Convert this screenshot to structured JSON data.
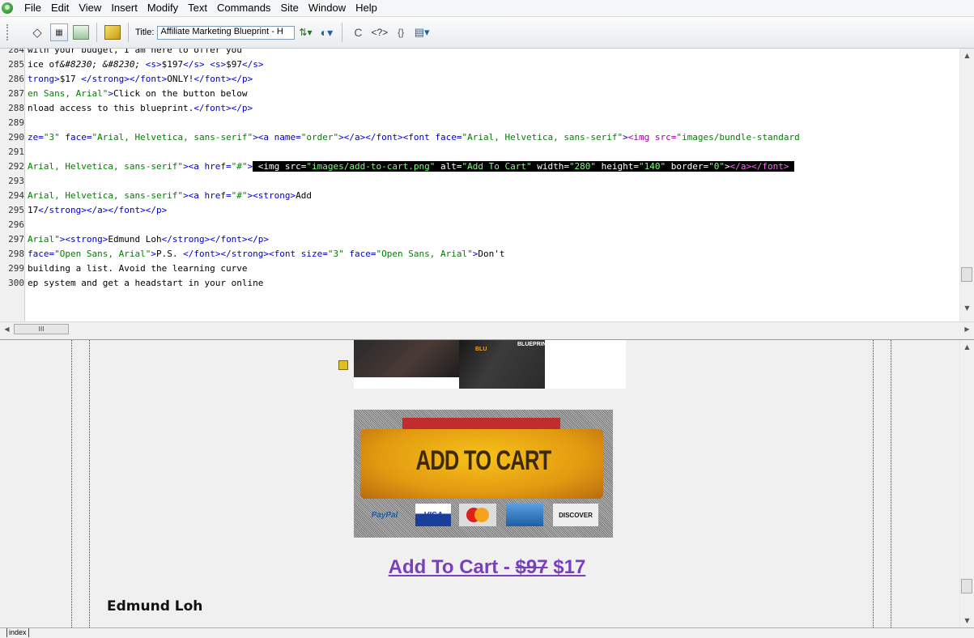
{
  "menu": [
    "File",
    "Edit",
    "View",
    "Insert",
    "Modify",
    "Text",
    "Commands",
    "Site",
    "Window",
    "Help"
  ],
  "toolbar": {
    "title_label": "Title:",
    "title_value": "Affiliate Marketing Blueprint - H",
    "code_glyph": "◇",
    "refresh_glyph": "C",
    "tag_glyph": "<?>",
    "brace_glyph": "{}"
  },
  "code_lines": [
    {
      "n": "284",
      "html": "<span class='txt'>with your budget, I am here to offer you</span>"
    },
    {
      "n": "285",
      "html": "<span class='txt'>ice of</span><span class='ent'>&amp;#8230; &amp;#8230;</span><span class='txt'> </span><span class='tag'>&lt;s&gt;</span><span class='txt'>$197</span><span class='tag'>&lt;/s&gt;</span><span class='txt'> </span><span class='tag'>&lt;s&gt;</span><span class='txt'>$97</span><span class='tag'>&lt;/s&gt;</span>"
    },
    {
      "n": "286",
      "html": "<span class='tag'>trong&gt;</span><span class='txt'>$17 </span><span class='tag'>&lt;/strong&gt;&lt;/font&gt;</span><span class='txt'>ONLY!</span><span class='tag'>&lt;/font&gt;&lt;/p&gt;</span>"
    },
    {
      "n": "287",
      "html": "<span class='str'>en Sans, Arial\"</span><span class='tag'>&gt;</span><span class='txt'>Click on the button below</span>"
    },
    {
      "n": "288",
      "html": "<span class='txt'>nload access to this blueprint.</span><span class='tag'>&lt;/font&gt;&lt;/p&gt;</span>"
    },
    {
      "n": "289",
      "html": ""
    },
    {
      "n": "290",
      "html": "<span class='attr'>ze=</span><span class='str'>\"3\"</span><span class='attr'> face=</span><span class='str'>\"Arial, Helvetica, sans-serif\"</span><span class='tag'>&gt;&lt;a name=</span><span class='str'>\"order\"</span><span class='tag'>&gt;&lt;/a&gt;&lt;/font&gt;&lt;font face=</span><span class='str'>\"Arial, Helvetica, sans-serif\"</span><span class='tag'>&gt;</span><span style='color:#a000a0'>&lt;img src=</span><span class='str'>\"images/bundle-standard</span>"
    },
    {
      "n": "291",
      "html": ""
    },
    {
      "n": "292",
      "html": "<span class='str'>Arial, Helvetica, sans-serif\"</span><span class='tag'>&gt;&lt;a href=</span><span class='str'>\"#\"</span><span class='tag'>&gt;</span><span class='hl'> &lt;img src=<span class='hls'>\"images/add-to-cart.png\"</span> alt=<span class='hls'>\"Add To Cart\"</span> width=<span class='hls'>\"280\"</span> height=<span class='hls'>\"140\"</span> border=<span class='hls'>\"0\"</span>&gt;<span class='hlt'>&lt;/a&gt;&lt;/font&gt;</span> </span>"
    },
    {
      "n": "293",
      "html": ""
    },
    {
      "n": "294",
      "html": "<span class='str'>Arial, Helvetica, sans-serif\"</span><span class='tag'>&gt;&lt;a href=</span><span class='str'>\"#\"</span><span class='tag'>&gt;&lt;strong&gt;</span><span class='txt'>Add</span>"
    },
    {
      "n": "295",
      "html": "<span class='txt'>17</span><span class='tag'>&lt;/strong&gt;&lt;/a&gt;&lt;/font&gt;&lt;/p&gt;</span>"
    },
    {
      "n": "296",
      "html": ""
    },
    {
      "n": "297",
      "html": "<span class='str'>Arial\"</span><span class='tag'>&gt;&lt;strong&gt;</span><span class='txt'>Edmund Loh</span><span class='tag'>&lt;/strong&gt;&lt;/font&gt;&lt;/p&gt;</span>"
    },
    {
      "n": "298",
      "html": "<span class='attr'>face=</span><span class='str'>\"Open Sans, Arial\"</span><span class='tag'>&gt;</span><span class='txt'>P.S. </span><span class='tag'>&lt;/font&gt;&lt;/strong&gt;&lt;font size=</span><span class='str'>\"3\"</span><span class='tag'> face=</span><span class='str'>\"Open Sans, Arial\"</span><span class='tag'>&gt;</span><span class='txt'>Don't</span>"
    },
    {
      "n": "299",
      "html": "<span class='txt'>building a list. Avoid the learning curve</span>"
    },
    {
      "n": "300",
      "html": "<span class='txt'>ep system and get a headstart in your online</span>"
    }
  ],
  "hscroll_thumb": "III",
  "bundle": {
    "label1": "BLU",
    "label2": "BLUEPRINT"
  },
  "cart_button": {
    "label": "ADD TO CART",
    "cards": [
      "PayPal",
      "VISA",
      "",
      "",
      "DISCOVER"
    ]
  },
  "cart_link": {
    "text": "Add To Cart - ",
    "old_price": "$97",
    "new_price": " $17"
  },
  "signature": "Edmund Loh",
  "tab": "index"
}
